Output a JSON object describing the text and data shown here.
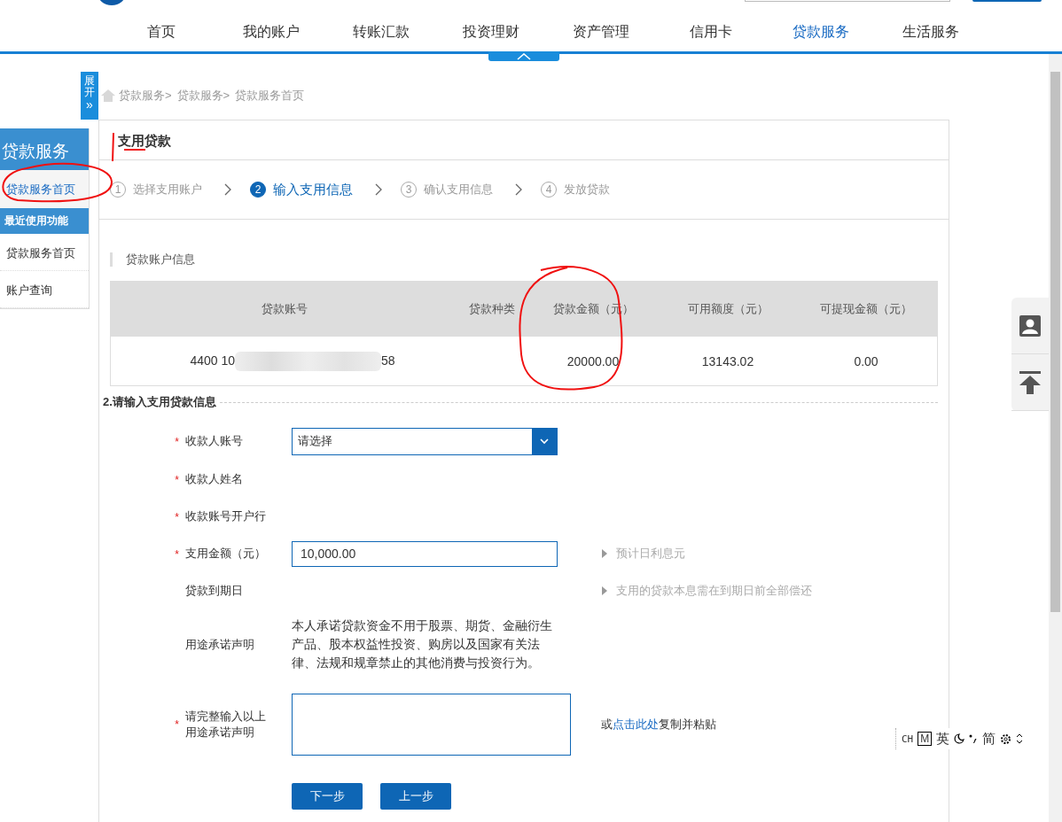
{
  "nav": {
    "items": [
      {
        "label": "首页",
        "selected": false
      },
      {
        "label": "我的账户",
        "selected": false
      },
      {
        "label": "转账汇款",
        "selected": false
      },
      {
        "label": "投资理财",
        "selected": false
      },
      {
        "label": "资产管理",
        "selected": false
      },
      {
        "label": "信用卡",
        "selected": false
      },
      {
        "label": "贷款服务",
        "selected": true
      },
      {
        "label": "生活服务",
        "selected": false
      }
    ]
  },
  "expand_tab": {
    "label": "展开",
    "icon": "»"
  },
  "breadcrumb": [
    "贷款服务>",
    "贷款服务>",
    "贷款服务首页"
  ],
  "sidebar": {
    "title": "贷款服务",
    "items": [
      {
        "label": "贷款服务首页",
        "selected": true
      }
    ],
    "recent_title": "最近使用功能",
    "recent_items": [
      {
        "label": "贷款服务首页"
      },
      {
        "label": "账户查询"
      }
    ]
  },
  "panel": {
    "title": "支用贷款",
    "steps": [
      {
        "number": "1",
        "label": "选择支用账户",
        "selected": false
      },
      {
        "number": "2",
        "label": "输入支用信息",
        "selected": true
      },
      {
        "number": "3",
        "label": "确认支用信息",
        "selected": false
      },
      {
        "number": "4",
        "label": "发放贷款",
        "selected": false
      }
    ],
    "account_section": "贷款账户信息",
    "table": {
      "columns": [
        "贷款账号",
        "贷款种类",
        "贷款金额（元）",
        "可用额度（元）",
        "可提现金额（元）"
      ],
      "rows": [
        {
          "account_prefix": "4400 10",
          "account_suffix": "58",
          "amount": "20000.00",
          "available": "13143.02",
          "withdrawable": "0.00"
        }
      ]
    },
    "form_title": "2.请输入支用贷款信息",
    "fields": [
      {
        "kind": "select",
        "label": "收款人账号",
        "required_mark": "*",
        "value": "请选择"
      },
      {
        "kind": "text",
        "label": "收款人姓名",
        "required_mark": "*"
      },
      {
        "kind": "text",
        "label": "收款账号开户行",
        "required_mark": "*"
      },
      {
        "kind": "input",
        "label": "支用金额（元）",
        "required_mark": "*",
        "value": "10,000.00",
        "hint": "预计日利息元"
      },
      {
        "kind": "text",
        "label": "贷款到期日",
        "hint": "支用的贷款本息需在到期日前全部偿还"
      },
      {
        "kind": "statement",
        "label": "用途承诺声明",
        "value": "本人承诺贷款资金不用于股票、期货、金融衍生产品、股本权益性投资、购房以及国家有关法律、法规和规章禁止的其他消费与投资行为。"
      },
      {
        "kind": "textarea",
        "label": "请完整输入以上用途承诺声明",
        "required_mark": "*",
        "hint_before": "或",
        "hint_link": "点击此处",
        "hint_after": "复制并粘贴"
      }
    ],
    "buttons": [
      "下一步",
      "上一步"
    ]
  },
  "ime_bar": {
    "items": [
      "CH",
      "M",
      "英",
      "简"
    ]
  }
}
